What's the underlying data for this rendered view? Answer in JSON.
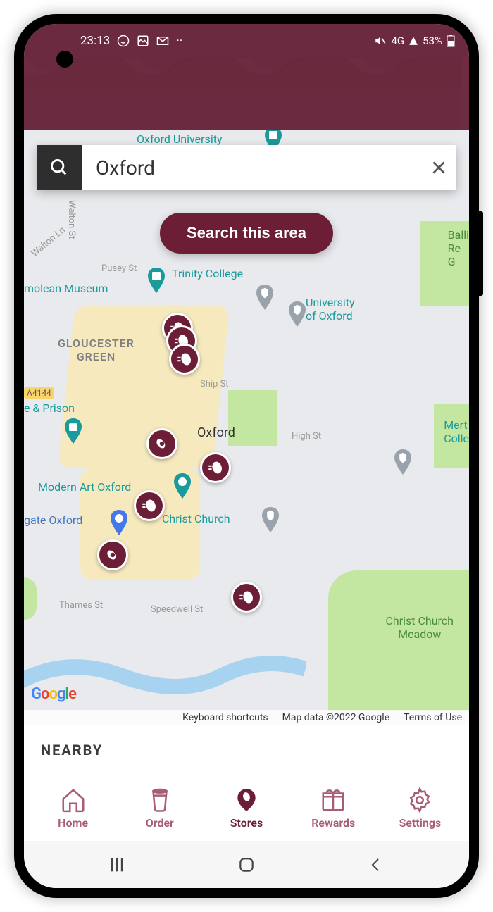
{
  "status": {
    "time": "23:13",
    "network": "4G",
    "battery_pct": "53%"
  },
  "search": {
    "value": "Oxford",
    "placeholder": "Search",
    "area_button": "Search this area"
  },
  "map": {
    "labels": {
      "oxford_university": "Oxford University",
      "trinity_college": "Trinity College",
      "university_of_oxford": "University\nof Oxford",
      "ashmolean": "molean Museum",
      "gloucester_green": "GLOUCESTER\nGREEN",
      "castle_prison": "e & Prison",
      "modern_art": "Modern Art Oxford",
      "westgate": "gate Oxford",
      "oxford_center": "Oxford",
      "christ_church": "Christ Church",
      "christ_church_meadow": "Christ Church\nMeadow",
      "merton": "Mert\nColle",
      "balliol": "Balli\nRe\nG",
      "walton_st": "Walton St",
      "pusey_st": "Pusey St",
      "ship_st": "Ship St",
      "high_st": "High St",
      "thames_st": "Thames St",
      "speedwell_st": "Speedwell St",
      "a4144": "A4144",
      "walton_ln": "Walton Ln"
    },
    "attribution": {
      "shortcuts": "Keyboard shortcuts",
      "data": "Map data ©2022 Google",
      "terms": "Terms of Use"
    },
    "google": "Google"
  },
  "nearby": {
    "title": "NEARBY"
  },
  "nav": {
    "home": "Home",
    "order": "Order",
    "stores": "Stores",
    "rewards": "Rewards",
    "settings": "Settings"
  }
}
